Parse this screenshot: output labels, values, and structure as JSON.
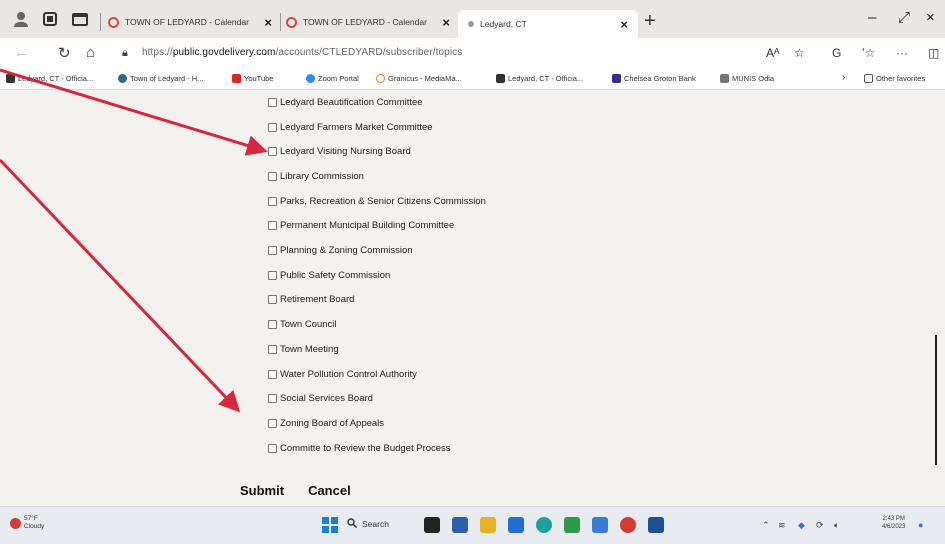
{
  "browser": {
    "tabs": [
      {
        "title": "TOWN OF LEDYARD - Calendar",
        "close": "×"
      },
      {
        "title": "TOWN OF LEDYARD - Calendar",
        "close": "×"
      },
      {
        "title": "Ledyard, CT",
        "close": "×"
      }
    ],
    "new_tab": "+",
    "window_controls": {
      "minimize": "–",
      "restore": "⤢",
      "close": "×"
    },
    "address": {
      "prefix": "https://",
      "domain": "public.govdelivery.com",
      "path": "/accounts/CTLEDYARD/subscriber/topics"
    },
    "toolbar": {
      "reading": "Aᴬ",
      "favorite": "☆",
      "refresh2": "G",
      "collections": "ʼ☆",
      "more": "···",
      "sidebar": "◫"
    },
    "bookmarks": [
      "Ledyard, CT - Officia...",
      "Town of Ledyard - H...",
      "YouTube",
      "Zoom Portal",
      "Granicus - MediaMa...",
      "Ledyard, CT - Officia...",
      "Chelsea Groton Bank",
      "MUNIS Odia",
      "›",
      "Other favorites"
    ]
  },
  "topics": [
    "Ledyard Beautification Committee",
    "Ledyard Farmers Market Committee",
    "Ledyard Visiting Nursing Board",
    "Library Commission",
    "Parks, Recreation & Senior Citizens Commission",
    "Permanent Municipal Building Committee",
    "Planning & Zoning Commission",
    "Public Safety Commission",
    "Retirement Board",
    "Town Council",
    "Town Meeting",
    "Water Pollution Control Authority",
    "Social Services Board",
    "Zoning Board of Appeals",
    "Committe to Review the Budget Process"
  ],
  "actions": {
    "submit": "Submit",
    "cancel": "Cancel"
  },
  "taskbar": {
    "weather_temp": "57°F",
    "weather_desc": "Cloudy",
    "search": "Search",
    "time": "2:43 PM",
    "date": "4/6/2023"
  },
  "colors": {
    "annotation_arrow": "#d7263d",
    "accent": "#1e7fd8"
  }
}
